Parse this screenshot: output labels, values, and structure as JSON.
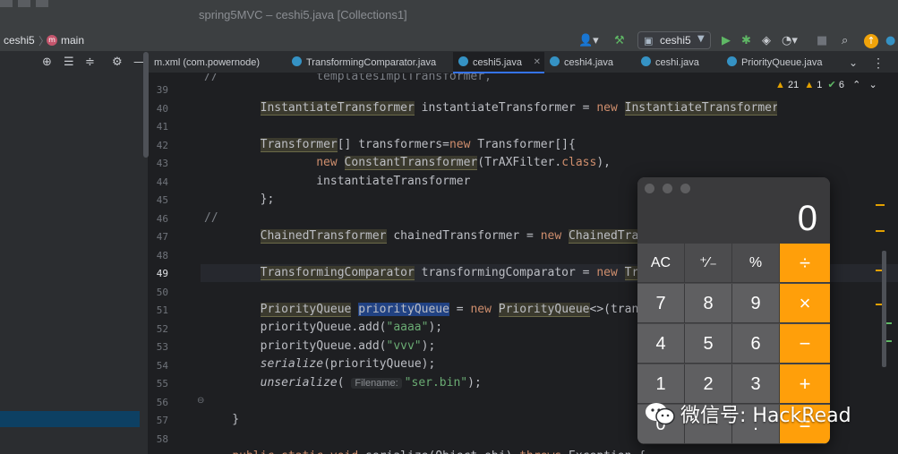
{
  "window": {
    "title": "spring5MVC – ceshi5.java [Collections1]"
  },
  "toolbar": {
    "project": "ceshi5",
    "module_icon": "m",
    "module": "main",
    "run_config": "ceshi5",
    "icons": [
      "user-icon",
      "hammer-icon",
      "run-icon",
      "debug-icon",
      "coverage-icon",
      "profile-icon",
      "stop-icon",
      "search-icon",
      "update-icon",
      "plugin-icon"
    ]
  },
  "tabs": [
    {
      "label": "m.xml (com.powernode)",
      "active": false,
      "has_icon": false
    },
    {
      "label": "TransformingComparator.java",
      "active": false,
      "has_icon": true
    },
    {
      "label": "ceshi5.java",
      "active": true,
      "has_icon": true
    },
    {
      "label": "ceshi4.java",
      "active": false,
      "has_icon": true
    },
    {
      "label": "ceshi.java",
      "active": false,
      "has_icon": true
    },
    {
      "label": "PriorityQueue.java",
      "active": false,
      "has_icon": true
    }
  ],
  "inspections": {
    "warnings": "21",
    "weak_warnings": "1",
    "ok": "6"
  },
  "editor": {
    "line_numbers": [
      "39",
      "40",
      "41",
      "42",
      "43",
      "44",
      "45",
      "46",
      "47",
      "48",
      "49",
      "50",
      "51",
      "52",
      "53",
      "54",
      "55",
      "56",
      "57",
      "58"
    ],
    "current_line": "49",
    "hint_label": "Filename:"
  },
  "calculator": {
    "display": "0",
    "keys": [
      [
        "AC",
        "⁺∕₋",
        "%",
        "÷"
      ],
      [
        "7",
        "8",
        "9",
        "×"
      ],
      [
        "4",
        "5",
        "6",
        "−"
      ],
      [
        "1",
        "2",
        "3",
        "+"
      ],
      [
        "0",
        "",
        ".",
        "="
      ]
    ]
  },
  "watermark": {
    "text": "微信号: HackRead"
  },
  "colors": {
    "accent": "#3574f0",
    "calc_operator": "#ff9f0a",
    "selection": "#214283"
  }
}
